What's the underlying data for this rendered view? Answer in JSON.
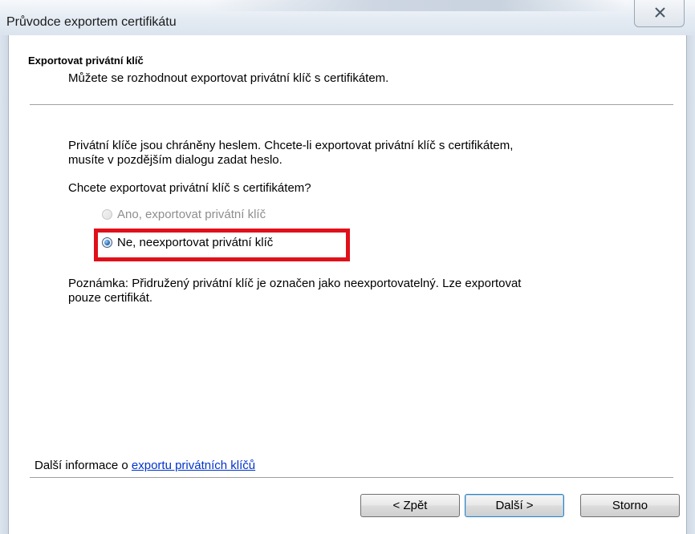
{
  "window": {
    "title": "Průvodce exportem certifikátu",
    "close_icon": "close-icon"
  },
  "header": {
    "title": "Exportovat privátní klíč",
    "subtitle": "Můžete se rozhodnout exportovat privátní klíč s certifikátem."
  },
  "content": {
    "intro_line1": "Privátní klíče jsou chráněny heslem. Chcete-li exportovat privátní klíč s certifikátem,",
    "intro_line2": "musíte v pozdějším dialogu zadat heslo.",
    "question": "Chcete exportovat privátní klíč s certifikátem?",
    "options": [
      {
        "label": "Ano, exportovat privátní klíč",
        "selected": false,
        "enabled": false
      },
      {
        "label": "Ne, neexportovat privátní klíč",
        "selected": true,
        "enabled": true
      }
    ],
    "note_line1": "Poznámka: Přidružený privátní klíč je označen jako neexportovatelný. Lze exportovat",
    "note_line2": "pouze certifikát."
  },
  "footer": {
    "more_info_prefix": "Další informace o ",
    "more_info_link": "exportu privátních klíčů",
    "back_label": "< Zpět",
    "next_label": "Další >",
    "cancel_label": "Storno"
  },
  "colors": {
    "highlight": "#e0101a",
    "link": "#0033cc"
  }
}
